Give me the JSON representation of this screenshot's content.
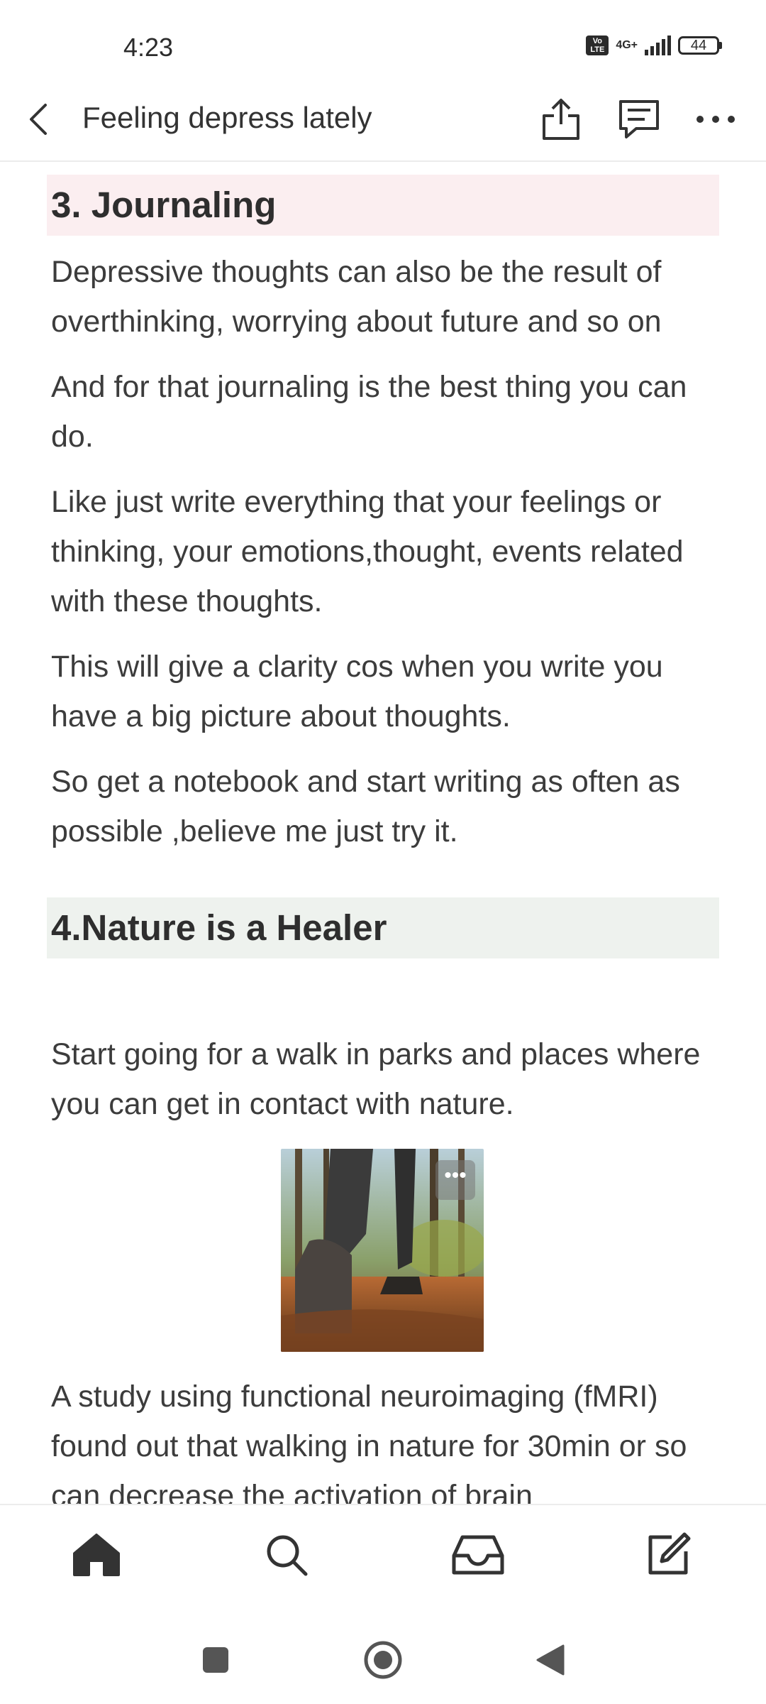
{
  "status_bar": {
    "time": "4:23",
    "volte_label": "Vo LTE",
    "network": "4G+",
    "battery": "44"
  },
  "header": {
    "title": "Feeling depress lately",
    "icons": [
      "back-arrow-icon",
      "share-icon",
      "comment-icon",
      "more-icon"
    ]
  },
  "article": {
    "section3_heading": "3. Journaling",
    "section3_bg": "#fbeef0",
    "p1": "Depressive thoughts can also be the result of overthinking, worrying about future and so on",
    "p2": "And for that journaling is the best thing you can do.",
    "p3": "Like just write everything that your feelings or thinking, your emotions,thought, events related with these thoughts.",
    "p4": "This will give a clarity cos when you write you have a big picture about thoughts.",
    "p5": " So get a notebook and start writing as often as possible ,believe me just try it.",
    "section4_heading": "4.Nature is a Healer",
    "section4_bg": "#eef2ee",
    "p6": "Start going for a walk in parks and places where you can get in contact with nature.",
    "image_more": "•••",
    "p7": "A study using functional neuroimaging (fMRI) found out that walking in nature for 30min or so  can decrease  the activation of brain"
  },
  "bottom_nav": {
    "icons": [
      "home-icon",
      "search-icon",
      "inbox-icon",
      "compose-icon"
    ]
  },
  "system_nav": {
    "icons": [
      "recents-icon",
      "home-circle-icon",
      "back-triangle-icon"
    ]
  }
}
